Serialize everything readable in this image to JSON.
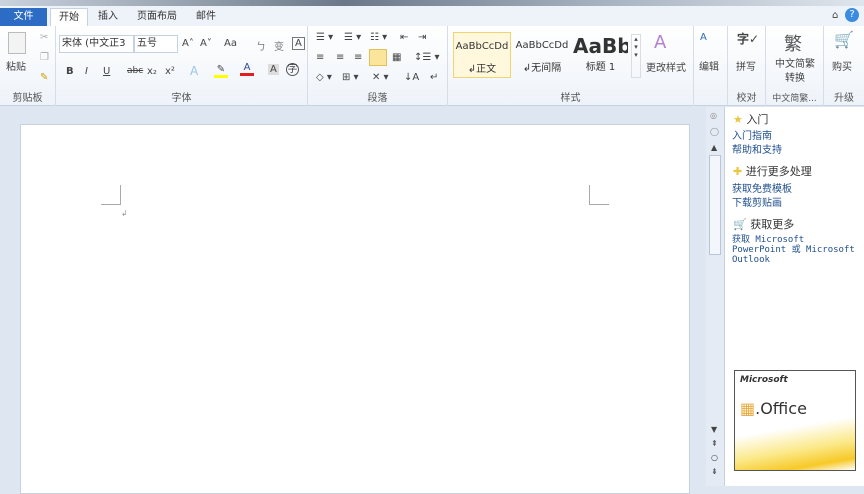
{
  "tabs": [
    "文件",
    "开始",
    "插入",
    "页面布局",
    "邮件"
  ],
  "clipboard": {
    "paste": "粘贴",
    "label": "剪贴板"
  },
  "font": {
    "name": "宋体 (中文正3",
    "size": "五号",
    "label": "字体",
    "bold": "B",
    "italic": "I",
    "underline": "U",
    "strike": "abc",
    "sub": "x₂",
    "sup": "x²",
    "grow": "A˄",
    "shrink": "A˅",
    "case": "Aa",
    "clear": "A"
  },
  "paragraph": {
    "label": "段落"
  },
  "styles": {
    "label": "样式",
    "items": [
      {
        "preview": "AaBbCcDd",
        "name": "↲正文"
      },
      {
        "preview": "AaBbCcDd",
        "name": "↲无间隔"
      },
      {
        "preview": "AaBb",
        "name": "标题 1"
      }
    ],
    "change": "更改样式"
  },
  "edit": {
    "label": "编辑"
  },
  "proofing": {
    "spell": "拼写",
    "label": "校对"
  },
  "chinese": {
    "button": "中文简繁转换",
    "label": "中文简繁..."
  },
  "upgrade": {
    "buy": "购买",
    "label": "升级"
  },
  "pane": {
    "h1": "入门",
    "l1": "入门指南",
    "l2": "帮助和支持",
    "h2": "进行更多处理",
    "l3": "获取免费模板",
    "l4": "下载剪贴画",
    "h3": "获取更多",
    "l5": "获取 Microsoft PowerPoint 或 Microsoft Outlook",
    "logo_brand": "Microsoft",
    "logo_product": ".Office"
  },
  "colors": {
    "file_tab": "#2d6cc4",
    "highlight": "#ffff00",
    "font_color": "#e02020"
  }
}
